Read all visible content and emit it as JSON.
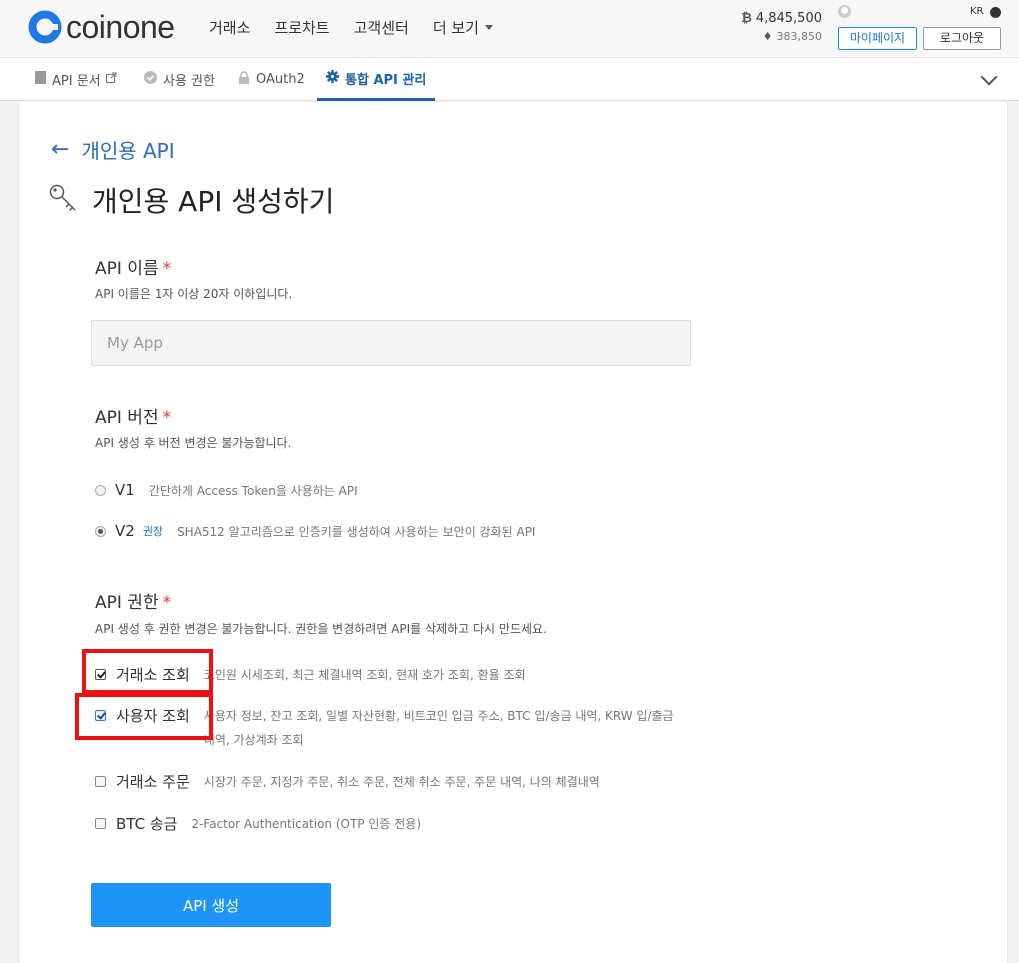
{
  "brand": {
    "name": "coinone",
    "color": "#1e78e8"
  },
  "nav": {
    "items": [
      "거래소",
      "프로차트",
      "고객센터",
      "더 보기"
    ]
  },
  "prices": {
    "btc_symbol": "₿",
    "btc": "4,845,500",
    "eth_symbol": "♦",
    "eth": "383,850"
  },
  "user": {
    "lang": "KR",
    "mypage": "마이페이지",
    "logout": "로그아웃"
  },
  "subnav": {
    "tabs": [
      {
        "label": "API 문서",
        "icon": "document-icon"
      },
      {
        "label": "사용 권한",
        "icon": "check-circle-icon"
      },
      {
        "label": "OAuth2",
        "icon": "lock-icon"
      },
      {
        "label": "통합 API 관리",
        "icon": "gear-icon",
        "active": true
      }
    ]
  },
  "back_label": "개인용 API",
  "page_title": "개인용 API 생성하기",
  "name_section": {
    "title": "API 이름",
    "required": "*",
    "hint": "API 이름은 1자 이상 20자 이하입니다.",
    "placeholder": "My App"
  },
  "version_section": {
    "title": "API 버전",
    "required": "*",
    "hint": "API 생성 후 버전 변경은 불가능합니다.",
    "options": [
      {
        "label": "V1",
        "badge": "",
        "desc": "간단하게 Access Token을 사용하는 API",
        "selected": false
      },
      {
        "label": "V2",
        "badge": "권장",
        "desc": "SHA512 알고리즘으로 인증키를 생성하여 사용하는 보안이 강화된 API",
        "selected": true
      }
    ]
  },
  "perm_section": {
    "title": "API 권한",
    "required": "*",
    "hint": "API 생성 후 권한 변경은 불가능합니다. 권한을 변경하려면 API를 삭제하고 다시 만드세요.",
    "items": [
      {
        "label": "거래소 조회",
        "desc": "코인원 시세조회, 최근 체결내역 조회, 현재 호가 조회, 환율 조회",
        "checked": true
      },
      {
        "label": "사용자 조회",
        "desc": "사용자 정보, 잔고 조회, 일별 자산현황, 비트코인 입금 주소, BTC 입/송금 내역, KRW 입/출금 내역, 가상계좌 조회",
        "checked": true
      },
      {
        "label": "거래소 주문",
        "desc": "시장가 주문, 지정가 주문, 취소 주문, 전체 취소 주문, 주문 내역, 나의 체결내역",
        "checked": false
      },
      {
        "label": "BTC 송금",
        "desc": "2-Factor Authentication (OTP 인증 전용)",
        "checked": false
      }
    ]
  },
  "submit_label": "API 생성",
  "colors": {
    "accent": "#1e93f8",
    "link": "#2a6db5",
    "highlight": "#ee1111"
  }
}
